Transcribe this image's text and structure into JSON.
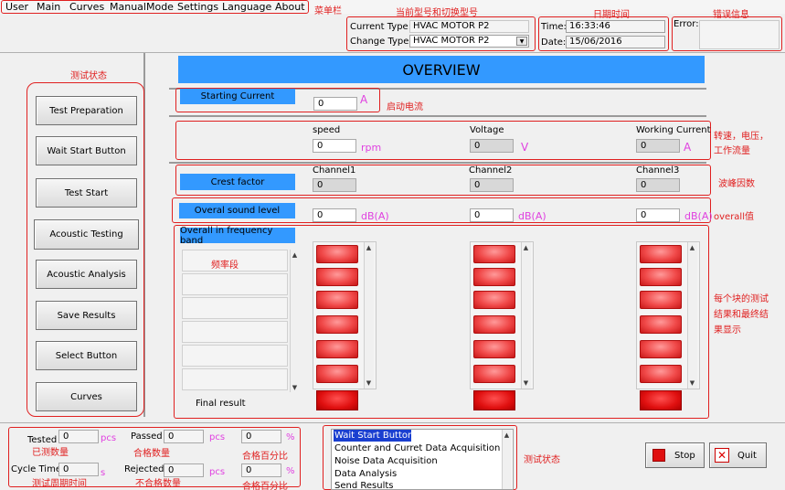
{
  "menu": [
    "User",
    "Main",
    "Curves",
    "ManualMode",
    "Settings",
    "Language",
    "About"
  ],
  "annotations": {
    "menubar": "菜单栏",
    "type": "当前型号和切换型号",
    "datetime": "日期时间",
    "error": "错误信息",
    "test_state": "测试状态",
    "start_current": "启动电流",
    "speed_group": "转速，电压，",
    "speed_group2": "工作流量",
    "crest": "波峰因数",
    "overall": "overall值",
    "band": "频率段",
    "result1": "每个块的测试",
    "result2": "结果和最终结",
    "result3": "果显示",
    "tested": "已测数量",
    "passed": "合格数量",
    "pass_pct": "合格百分比",
    "cycle": "测试周期时间",
    "rejected": "不合格数量",
    "rej_pct": "合格百分比",
    "status": "测试状态"
  },
  "type": {
    "current_label": "Current Type:",
    "current_value": "HVAC MOTOR P2",
    "change_label": "Change Type:",
    "change_value": "HVAC MOTOR P2"
  },
  "datetime": {
    "time_label": "Time:",
    "time_value": "16:33:46",
    "date_label": "Date:",
    "date_value": "15/06/2016"
  },
  "error": {
    "label": "Error:"
  },
  "overview_title": "OVERVIEW",
  "starting_current": {
    "label": "Starting  Current",
    "value": "0",
    "unit": "A"
  },
  "speed": {
    "label": "speed",
    "value": "0",
    "unit": "rpm"
  },
  "voltage": {
    "label": "Voltage",
    "value": "0",
    "unit": "V"
  },
  "working_current": {
    "label": "Working Current",
    "value": "0",
    "unit": "A"
  },
  "crest": {
    "label": "Crest factor",
    "channels": [
      "Channel1",
      "Channel2",
      "Channel3"
    ],
    "values": [
      "0",
      "0",
      "0"
    ]
  },
  "overall": {
    "label": "Overal sound level",
    "values": [
      "0",
      "0",
      "0"
    ],
    "unit": "dB(A)"
  },
  "band": {
    "label": "Overall in frequency band",
    "final_label": "Final result"
  },
  "left_buttons": [
    "Test Preparation",
    "Wait Start Button",
    "Test Start",
    "Acoustic Testing",
    "Acoustic  Analysis",
    "Save Results",
    "Select Button",
    "Curves"
  ],
  "stats": {
    "tested_label": "Tested",
    "tested_value": "0",
    "passed_label": "Passed",
    "passed_value": "0",
    "cycle_label": "Cycle Time",
    "cycle_value": "0",
    "cycle_unit": "s",
    "rejected_label": "Rejected",
    "rejected_value": "0",
    "pcs": "pcs",
    "pct_value1": "0",
    "pct_value2": "0",
    "pct": "%"
  },
  "status_list": [
    "Wait Start Button",
    "Counter and Curret Data Acquisition",
    "Noise Data Acquisition",
    "Data Analysis",
    "Send Results"
  ],
  "buttons": {
    "stop": "Stop",
    "quit": "Quit"
  },
  "colors": {
    "accent": "#3399ff",
    "led": "#f04848",
    "annotation": "#e02020",
    "unit": "#e040e0"
  }
}
